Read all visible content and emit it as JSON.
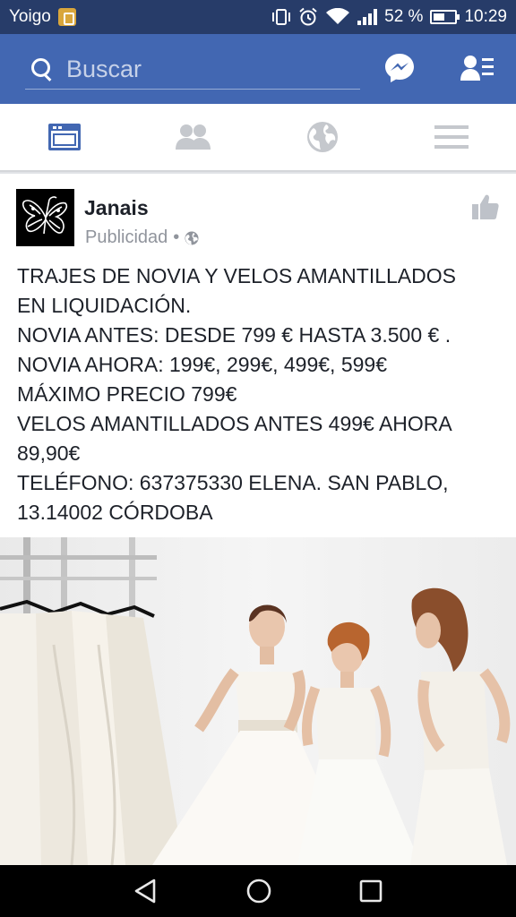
{
  "status_bar": {
    "carrier": "Yoigo",
    "battery_percent": "52 %",
    "time": "10:29",
    "icons": [
      "vibrate-icon",
      "alarm-icon",
      "wifi-icon",
      "signal-icon",
      "battery-icon"
    ]
  },
  "header": {
    "search_placeholder": "Buscar",
    "icons": [
      "search-icon",
      "messenger-icon",
      "friend-requests-icon"
    ],
    "color": "#4267b2"
  },
  "tabs": [
    {
      "name": "news-feed",
      "icon": "news-feed-icon",
      "active": true
    },
    {
      "name": "friends",
      "icon": "friends-icon",
      "active": false
    },
    {
      "name": "notifications",
      "icon": "globe-icon",
      "active": false
    },
    {
      "name": "menu",
      "icon": "menu-icon",
      "active": false
    }
  ],
  "post": {
    "page_name": "Janais",
    "sponsored_label": "Publicidad",
    "separator": "•",
    "text": "TRAJES DE NOVIA Y VELOS AMANTILLADOS\nEN LIQUIDACIÓN.\nNOVIA ANTES: DESDE 799 € HASTA 3.500 € .\nNOVIA AHORA: 199€, 299€, 499€, 599€\nMÁXIMO PRECIO 799€\nVELOS AMANTILLADOS ANTES 499€ AHORA\n89,90€\nTELÉFONO: 637375330 ELENA. SAN PABLO,\n13.14002 CÓRDOBA",
    "avatar_icon": "butterfly-logo-icon",
    "photo": "brides-in-wedding-dresses"
  },
  "nav_bar": {
    "icons": [
      "back-icon",
      "home-icon",
      "recents-icon"
    ]
  },
  "colors": {
    "status_bar": "#273c69",
    "app_bar": "#4267b2",
    "text": "#1d2129",
    "muted": "#90949c"
  }
}
